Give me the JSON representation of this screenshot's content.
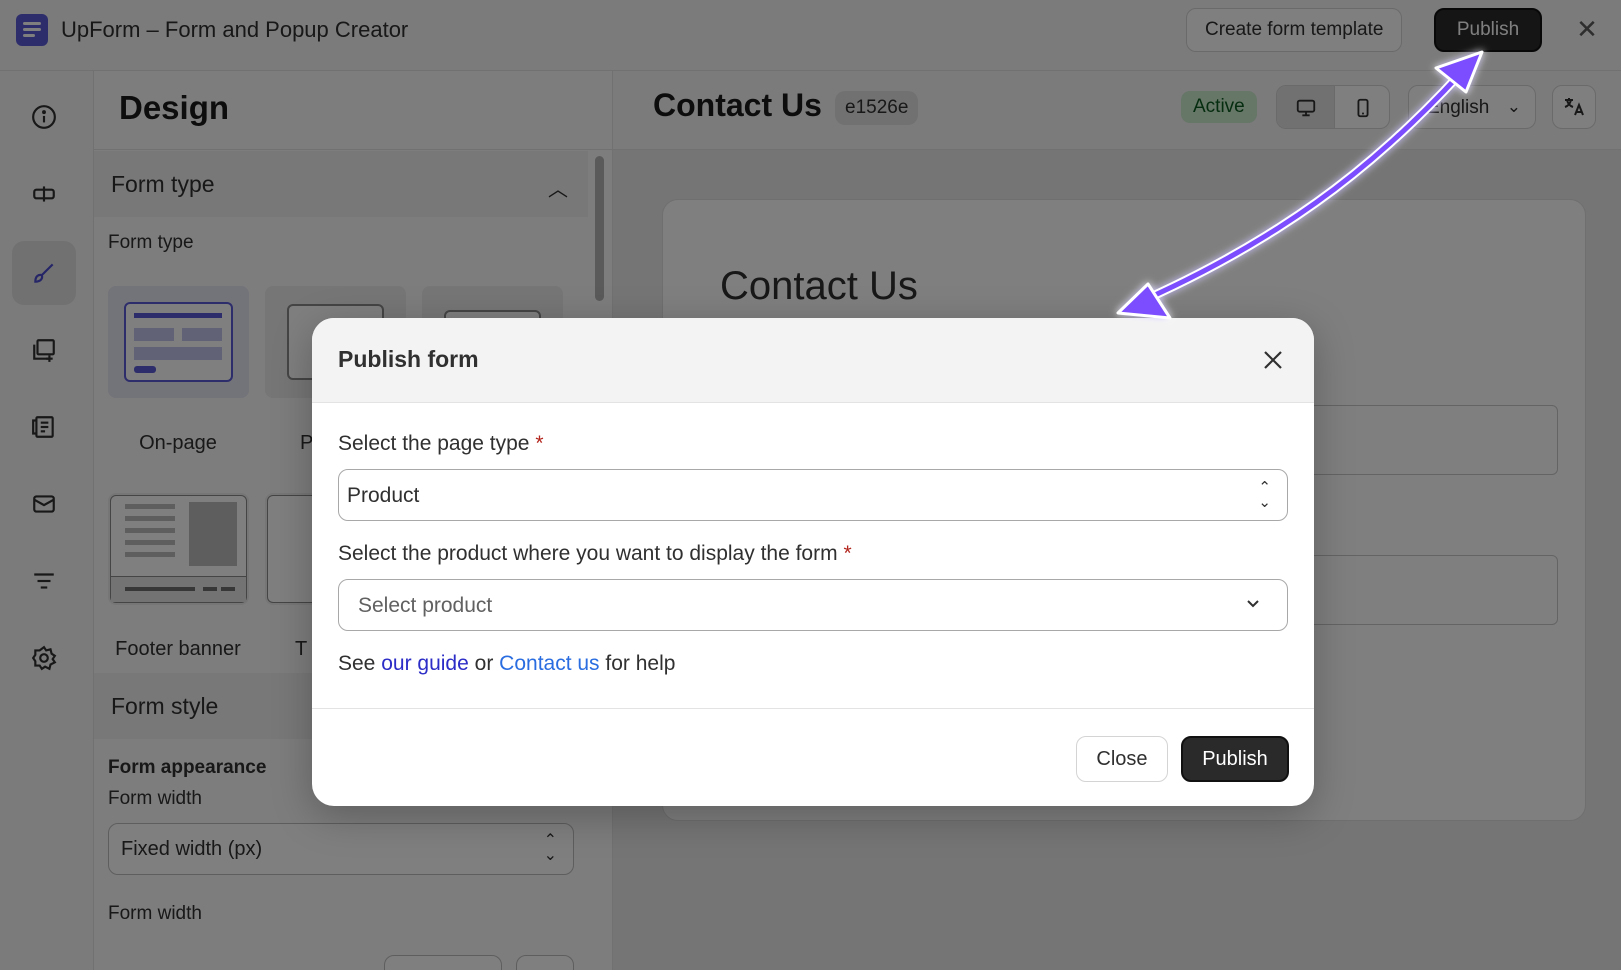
{
  "app": {
    "title": "UpForm – Form and Popup Creator",
    "create_template_label": "Create form template",
    "publish_label": "Publish"
  },
  "design": {
    "title": "Design",
    "form_type_section": "Form type",
    "form_type_label": "Form type",
    "thumb_labels": [
      "On-page",
      "P",
      "",
      "Footer banner",
      "T",
      ""
    ],
    "form_style_section": "Form style",
    "form_appearance_label": "Form appearance",
    "form_width_label": "Form width",
    "form_width_value": "Fixed width (px)",
    "form_width_label_2": "Form width"
  },
  "preview": {
    "title": "Contact Us",
    "id_badge": "e1526e",
    "status": "Active",
    "language": "English",
    "form_title": "Contact Us"
  },
  "modal": {
    "title": "Publish form",
    "page_type_label": "Select the page type",
    "page_type_value": "Product",
    "product_label": "Select the product where you want to display the form",
    "product_placeholder": "Select product",
    "help_prefix": "See",
    "help_guide": "our guide",
    "help_or": "or",
    "help_contact": "Contact us",
    "help_suffix": "for help",
    "close_label": "Close",
    "publish_label": "Publish"
  },
  "colors": {
    "annotation_arrow": "#7c4dff",
    "primary_button": "#2a2a2a",
    "active_badge": "#cdeccf",
    "link": "#2a6de1"
  }
}
